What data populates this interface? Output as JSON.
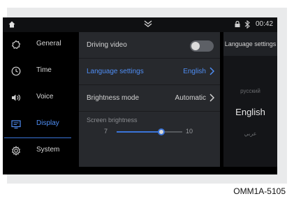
{
  "status_bar": {
    "home_icon": "home-icon",
    "dropdown_icon": "chevron-down-icon",
    "lock_icon": "lock-icon",
    "bluetooth_icon": "bluetooth-icon",
    "time": "00:42"
  },
  "sidebar": {
    "items": [
      {
        "label": "General",
        "icon": "gear-outline-icon"
      },
      {
        "label": "Time",
        "icon": "clock-icon"
      },
      {
        "label": "Voice",
        "icon": "speaker-icon"
      },
      {
        "label": "Display",
        "icon": "display-icon",
        "active": true
      },
      {
        "label": "System",
        "icon": "cog-icon"
      }
    ]
  },
  "settings": {
    "driving_video": {
      "label": "Driving video",
      "enabled": false
    },
    "language": {
      "label": "Language settings",
      "value": "English"
    },
    "brightness_mode": {
      "label": "Brightness mode",
      "value": "Automatic"
    },
    "screen_brightness": {
      "label": "Screen brightness",
      "min": "7",
      "max": "10",
      "level": 0.68
    }
  },
  "language_panel": {
    "header": "Language settings",
    "above": "русский",
    "selected": "English",
    "below": "عربي"
  },
  "footer": {
    "code": "OMM1A-5105"
  },
  "colors": {
    "accent": "#4f8ef5",
    "panel": "#27292d",
    "background": "#000000"
  }
}
